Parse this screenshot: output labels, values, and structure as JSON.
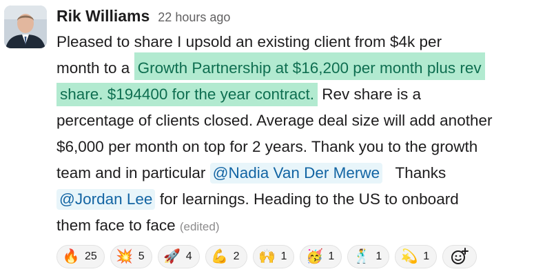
{
  "message": {
    "author": "Rik Williams",
    "timestamp": "22 hours ago",
    "lines": [
      [
        "Pleased to share I upsold an existing client from $4k per"
      ],
      [
        "month to a ",
        "Growth Partnership at $16,200 per month plus rev"
      ],
      [
        "share. $194400 for the year contract.",
        " Rev share is a"
      ],
      [
        "percentage of clients closed. Average deal size will add another"
      ],
      [
        "$6,000 per month on top for 2 years. Thank you to the growth"
      ],
      [
        "team and in particular ",
        "@Nadia Van Der Merwe",
        "   Thanks"
      ],
      [
        "@Jordan Lee",
        " for learnings. Heading to the US to onboard"
      ],
      [
        "them face to face ",
        "(edited)"
      ]
    ]
  },
  "reactions": [
    {
      "emoji": "fire-emoji",
      "glyph": "🔥",
      "count": "25"
    },
    {
      "emoji": "collision-emoji",
      "glyph": "💥",
      "count": "5"
    },
    {
      "emoji": "rocket-emoji",
      "glyph": "🚀",
      "count": "4"
    },
    {
      "emoji": "flexed-biceps-emoji",
      "glyph": "💪",
      "count": "2"
    },
    {
      "emoji": "raising-hands-emoji",
      "glyph": "🙌",
      "count": "1"
    },
    {
      "emoji": "partying-face-emoji",
      "glyph": "🥳",
      "count": "1"
    },
    {
      "emoji": "dancing-emoji",
      "glyph": "🕺",
      "count": "1"
    },
    {
      "emoji": "dizzy-emoji",
      "glyph": "💫",
      "count": "1"
    }
  ],
  "colors": {
    "highlight_bg": "#b2ead0",
    "highlight_text": "#0e6e50",
    "mention_bg": "#e8f5fa",
    "mention_text": "#1264a3"
  }
}
